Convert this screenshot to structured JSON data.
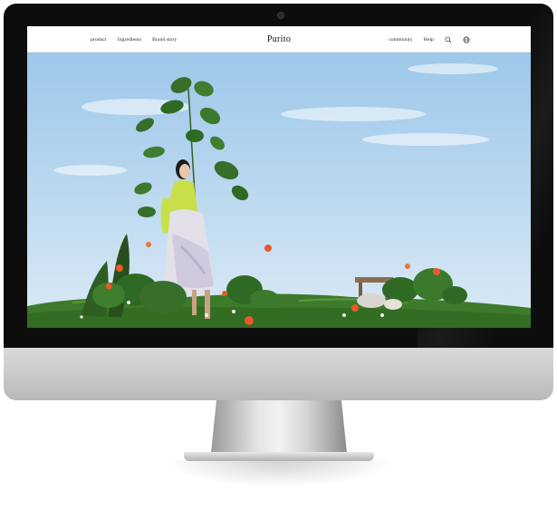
{
  "site": {
    "brand": "Purito",
    "nav_left": [
      "product",
      "Ingredients",
      "Brand story"
    ],
    "nav_right": [
      "community",
      "Help"
    ],
    "icons": [
      "search-icon",
      "globe-icon"
    ]
  },
  "colors": {
    "sky": "#b7d6ef",
    "grass": "#3f7a2d",
    "flower": "#e85a2a",
    "monitor": "#0d0d0d"
  }
}
